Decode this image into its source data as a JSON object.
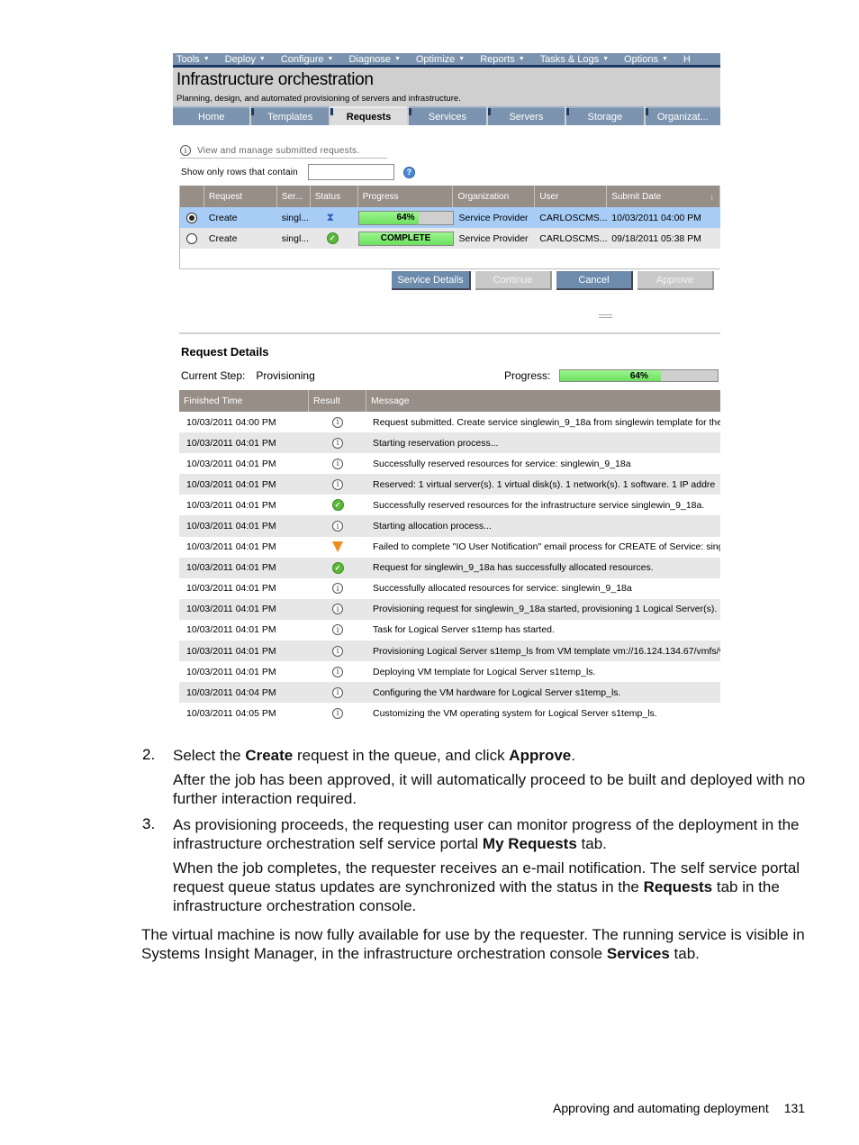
{
  "app": {
    "menu": [
      "Tools",
      "Deploy",
      "Configure",
      "Diagnose",
      "Optimize",
      "Reports",
      "Tasks & Logs",
      "Options",
      "H"
    ],
    "title": "Infrastructure orchestration",
    "subtitle": "Planning, design, and automated provisioning of servers and infrastructure.",
    "tabs": [
      {
        "label": "Home",
        "active": false
      },
      {
        "label": "Templates",
        "active": false
      },
      {
        "label": "Requests",
        "active": true
      },
      {
        "label": "Services",
        "active": false
      },
      {
        "label": "Servers",
        "active": false
      },
      {
        "label": "Storage",
        "active": false
      },
      {
        "label": "Organizat...",
        "active": false
      }
    ],
    "info_text": "View and manage submitted requests.",
    "filter": {
      "label": "Show only rows that contain",
      "value": "",
      "help_icon": "?"
    },
    "requests": {
      "columns": [
        "",
        "Request",
        "Ser...",
        "Status",
        "Progress",
        "Organization",
        "User",
        "Submit Date"
      ],
      "sort_icon": "↓",
      "rows": [
        {
          "selected": true,
          "request": "Create",
          "service": "singl...",
          "status": "in-progress",
          "progress_label": "64%",
          "progress": 0.64,
          "organization": "Service Provider",
          "user": "CARLOSCMS...",
          "submit_date": "10/03/2011 04:00 PM"
        },
        {
          "selected": false,
          "request": "Create",
          "service": "singl...",
          "status": "complete",
          "progress_label": "COMPLETE",
          "progress": 1.0,
          "organization": "Service Provider",
          "user": "CARLOSCMS...",
          "submit_date": "09/18/2011 05:38 PM"
        }
      ]
    },
    "buttons": [
      {
        "label": "Service Details",
        "enabled": true
      },
      {
        "label": "Continue",
        "enabled": false
      },
      {
        "label": "Cancel",
        "enabled": true
      },
      {
        "label": "Approve",
        "enabled": false
      }
    ],
    "details": {
      "title": "Request Details",
      "current_step_label": "Current Step:",
      "current_step": "Provisioning",
      "progress_label": "Progress:",
      "progress_text": "64%",
      "progress": 0.64,
      "columns": [
        "Finished Time",
        "Result",
        "Message"
      ],
      "rows": [
        {
          "time": "10/03/2011 04:00 PM",
          "result": "info",
          "message": "Request submitted. Create service singlewin_9_18a from singlewin template for the"
        },
        {
          "time": "10/03/2011 04:01 PM",
          "result": "info",
          "message": "Starting reservation process..."
        },
        {
          "time": "10/03/2011 04:01 PM",
          "result": "info",
          "message": "Successfully reserved resources for service: singlewin_9_18a"
        },
        {
          "time": "10/03/2011 04:01 PM",
          "result": "info",
          "message": "Reserved: 1 virtual server(s). 1 virtual disk(s). 1 network(s). 1 software. 1 IP addre"
        },
        {
          "time": "10/03/2011 04:01 PM",
          "result": "success",
          "message": "Successfully reserved resources for the infrastructure service singlewin_9_18a."
        },
        {
          "time": "10/03/2011 04:01 PM",
          "result": "info",
          "message": "Starting allocation process..."
        },
        {
          "time": "10/03/2011 04:01 PM",
          "result": "warning",
          "message": "Failed to complete \"IO User Notification\" email process for CREATE of Service: singl"
        },
        {
          "time": "10/03/2011 04:01 PM",
          "result": "success",
          "message": "Request for singlewin_9_18a has successfully allocated resources."
        },
        {
          "time": "10/03/2011 04:01 PM",
          "result": "info",
          "message": "Successfully allocated resources for service: singlewin_9_18a"
        },
        {
          "time": "10/03/2011 04:01 PM",
          "result": "info",
          "message": "Provisioning request for singlewin_9_18a started, provisioning 1 Logical Server(s)."
        },
        {
          "time": "10/03/2011 04:01 PM",
          "result": "info",
          "message": "Task for Logical Server s1temp has started."
        },
        {
          "time": "10/03/2011 04:01 PM",
          "result": "info",
          "message": "Provisioning Logical Server s1temp_ls from VM template vm://16.124.134.67/vmfs/v"
        },
        {
          "time": "10/03/2011 04:01 PM",
          "result": "info",
          "message": "Deploying VM template for Logical Server s1temp_ls."
        },
        {
          "time": "10/03/2011 04:04 PM",
          "result": "info",
          "message": "Configuring the VM hardware for Logical Server s1temp_ls."
        },
        {
          "time": "10/03/2011 04:05 PM",
          "result": "info",
          "message": "Customizing the VM operating system for Logical Server s1temp_ls."
        }
      ]
    }
  },
  "doc": {
    "step2": {
      "num": "2.",
      "pre": "Select the ",
      "b1": "Create",
      "mid": " request in the queue, and click ",
      "b2": "Approve",
      "post": ".",
      "para": "After the job has been approved, it will automatically proceed to be built and deployed with no further interaction required."
    },
    "step3": {
      "num": "3.",
      "pre": "As provisioning proceeds, the requesting user can monitor progress of the deployment in the infrastructure orchestration self service portal ",
      "b1": "My Requests",
      "post": " tab.",
      "para_pre": "When the job completes, the requester receives an e-mail notification. The self service portal request queue status updates are synchronized with the status in the ",
      "para_b": "Requests",
      "para_post": " tab in the infrastructure orchestration console."
    },
    "closing": {
      "pre": "The virtual machine is now fully available for use by the requester. The running service is visible in Systems Insight Manager, in the infrastructure orchestration console ",
      "b": "Services",
      "post": " tab."
    },
    "footer": {
      "section": "Approving and automating deployment",
      "page": "131"
    }
  }
}
